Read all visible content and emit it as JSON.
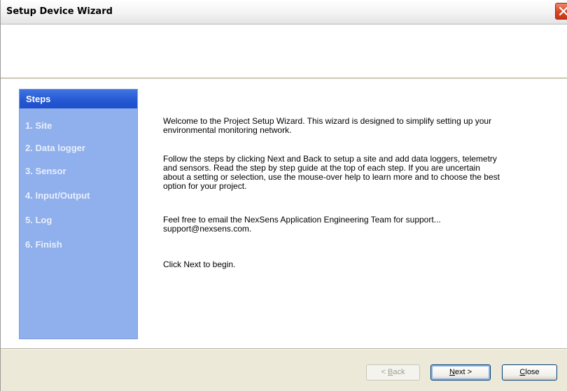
{
  "window": {
    "title": "Setup Device Wizard"
  },
  "steps": {
    "header": "Steps",
    "items": [
      "1. Site",
      "2. Data logger",
      "3. Sensor",
      "4. Input/Output",
      "5. Log",
      "6. Finish"
    ]
  },
  "welcome": {
    "paragraph_1_line_1": "Welcome to the Project Setup Wizard. This wizard is designed to simplify setting up your",
    "paragraph_1_line_2": "environmental monitoring network.",
    "paragraph_2_line_1": "Follow the steps by clicking Next and Back to setup a site and add data loggers, telemetry",
    "paragraph_2_line_2": "and sensors. Read the step by step guide at the top of each step. If you are uncertain",
    "paragraph_2_line_3": "about a setting or selection, use the mouse-over help to learn more and to choose the best",
    "paragraph_2_line_4": "option for your project.",
    "paragraph_3_line_1": "Feel free to email the NexSens Application Engineering Team for support...",
    "paragraph_3_line_2": "support@nexsens.com.",
    "paragraph_4": "Click Next to begin."
  },
  "buttons": {
    "back_prefix": "< ",
    "back_accel": "B",
    "back_rest": "ack",
    "next_accel": "N",
    "next_rest": "ext >",
    "close_accel": "C",
    "close_rest": "lose"
  },
  "icons": {
    "close": "close-x-icon"
  },
  "colors": {
    "steps_panel": "#8fb0ec",
    "steps_header": "#2457d3",
    "close_button": "#d9482a"
  }
}
